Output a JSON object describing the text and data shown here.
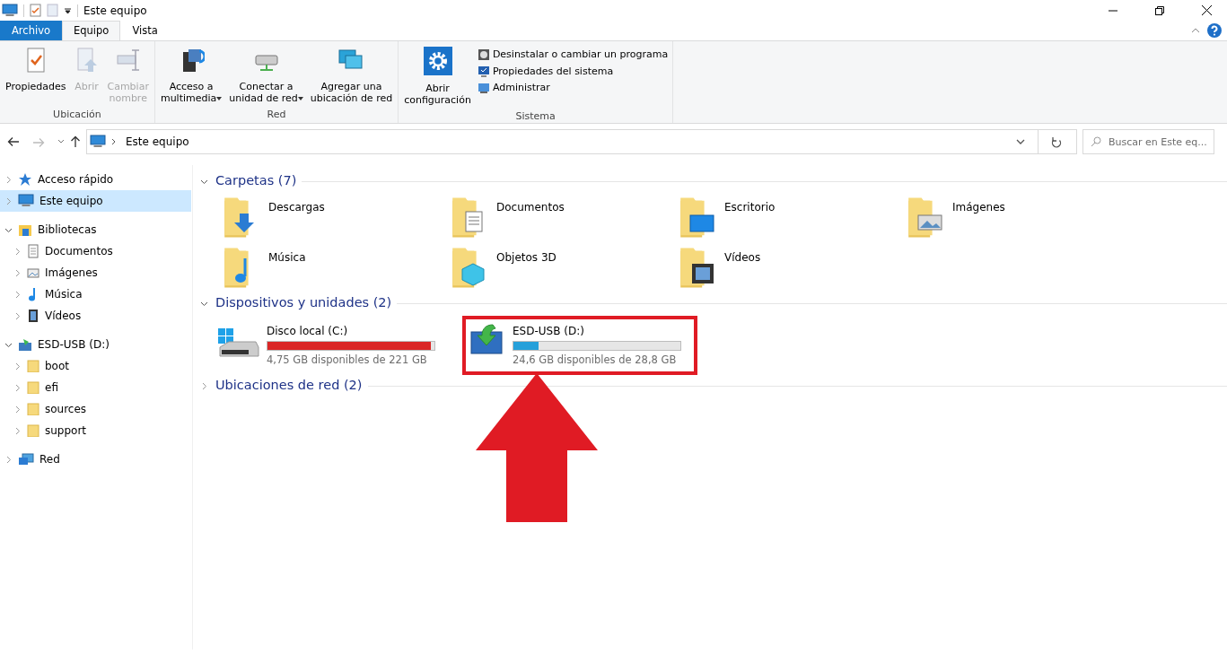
{
  "window": {
    "title": "Este equipo"
  },
  "ribbon_tabs": [
    {
      "label": "Archivo",
      "kind": "file",
      "selected": false
    },
    {
      "label": "Equipo",
      "kind": "tab",
      "selected": true
    },
    {
      "label": "Vista",
      "kind": "tab",
      "selected": false
    }
  ],
  "ribbon_groups": [
    {
      "label": "Ubicación",
      "buttons": [
        {
          "label": "Propiedades",
          "disabled": false,
          "dropdown": false
        },
        {
          "label": "Abrir",
          "disabled": true,
          "dropdown": false
        },
        {
          "label": "Cambiar\nnombre",
          "disabled": true,
          "dropdown": false
        }
      ]
    },
    {
      "label": "Red",
      "buttons": [
        {
          "label": "Acceso a\nmultimedia",
          "disabled": false,
          "dropdown": true
        },
        {
          "label": "Conectar a\nunidad de red",
          "disabled": false,
          "dropdown": true
        },
        {
          "label": "Agregar una\nubicación de red",
          "disabled": false,
          "dropdown": false
        }
      ]
    },
    {
      "label": "Sistema",
      "buttons": [
        {
          "label": "Abrir\nconfiguración",
          "disabled": false,
          "dropdown": false
        }
      ],
      "small_buttons": [
        {
          "label": "Desinstalar o cambiar un programa"
        },
        {
          "label": "Propiedades del sistema"
        },
        {
          "label": "Administrar"
        }
      ]
    }
  ],
  "address": {
    "path": "Este equipo"
  },
  "search": {
    "placeholder": "Buscar en Este eq..."
  },
  "sidebar": {
    "items": [
      {
        "label": "Acceso rápido",
        "expanded": false,
        "selected": false
      },
      {
        "label": "Este equipo",
        "expanded": false,
        "selected": true
      },
      {
        "label": "Bibliotecas",
        "expanded": true,
        "selected": false,
        "children": [
          {
            "label": "Documentos",
            "expanded": false,
            "selected": false
          },
          {
            "label": "Imágenes",
            "expanded": false,
            "selected": false
          },
          {
            "label": "Música",
            "expanded": false,
            "selected": false
          },
          {
            "label": "Vídeos",
            "expanded": false,
            "selected": false
          }
        ]
      },
      {
        "label": "ESD-USB (D:)",
        "expanded": true,
        "selected": false,
        "children": [
          {
            "label": "boot",
            "expanded": false,
            "selected": false
          },
          {
            "label": "efi",
            "expanded": false,
            "selected": false
          },
          {
            "label": "sources",
            "expanded": false,
            "selected": false
          },
          {
            "label": "support",
            "expanded": false,
            "selected": false
          }
        ]
      },
      {
        "label": "Red",
        "expanded": false,
        "selected": false
      }
    ]
  },
  "sections": [
    {
      "title": "Carpetas (7)",
      "expanded": true,
      "kind": "folders",
      "items": [
        {
          "label": "Descargas"
        },
        {
          "label": "Documentos"
        },
        {
          "label": "Escritorio"
        },
        {
          "label": "Imágenes"
        },
        {
          "label": "Música"
        },
        {
          "label": "Objetos 3D"
        },
        {
          "label": "Vídeos"
        }
      ]
    },
    {
      "title": "Dispositivos y unidades (2)",
      "expanded": true,
      "kind": "drives",
      "items": [
        {
          "label": "Disco local (C:)",
          "level": 0.98,
          "color": "#da2626",
          "free": "4,75 GB disponibles de 221 GB",
          "highlighted": false
        },
        {
          "label": "ESD-USB (D:)",
          "level": 0.15,
          "color": "#26a0da",
          "free": "24,6 GB disponibles de 28,8 GB",
          "highlighted": true
        }
      ]
    },
    {
      "title": "Ubicaciones de red (2)",
      "expanded": false,
      "kind": "network"
    }
  ]
}
